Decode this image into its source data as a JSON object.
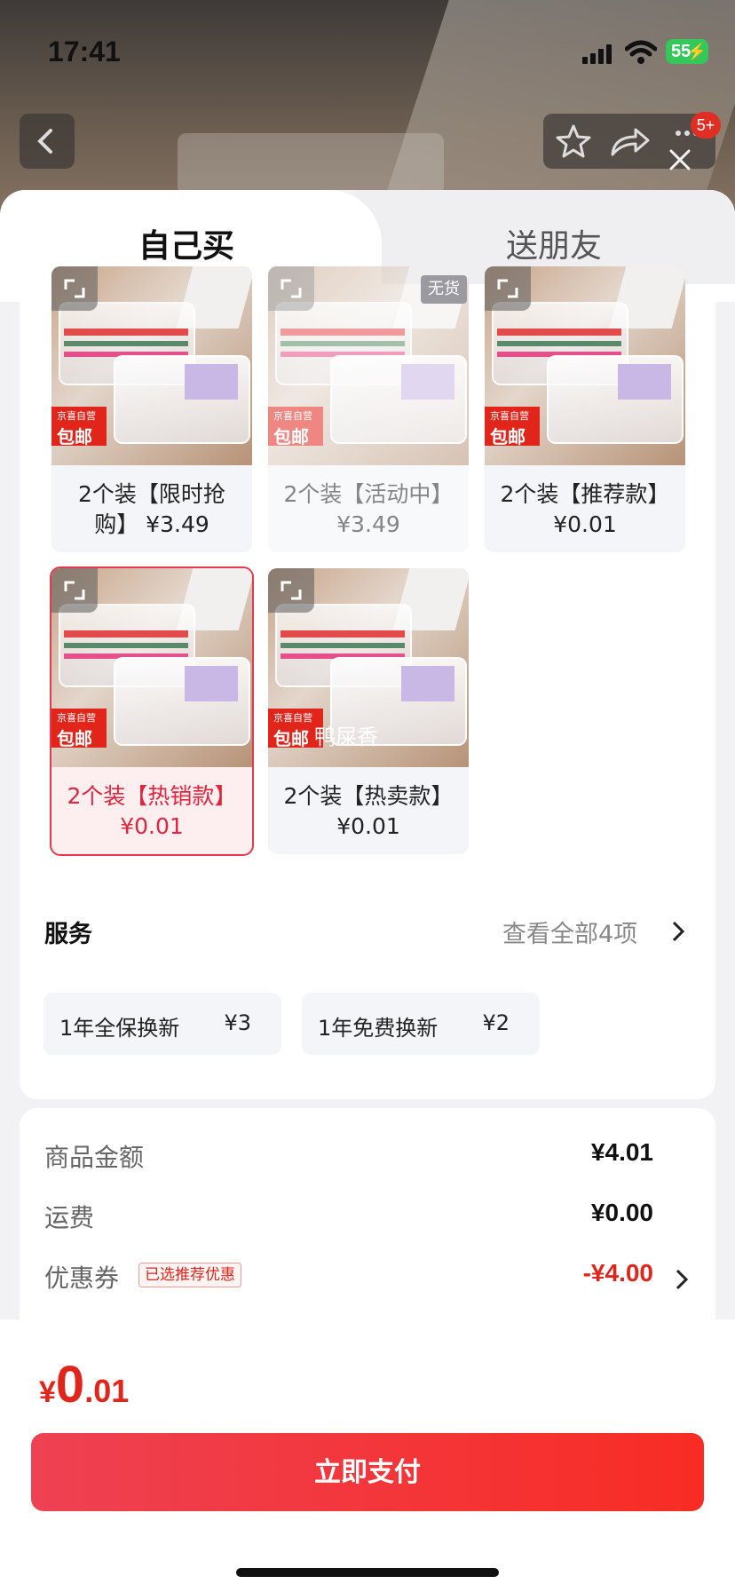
{
  "status_bar": {
    "time": "17:41",
    "battery": "55"
  },
  "nav": {
    "badge": "5+"
  },
  "tabs": [
    {
      "label": "自己买"
    },
    {
      "label": "送朋友"
    }
  ],
  "skus": [
    {
      "label": "2个装【限时抢购】 ¥3.49",
      "tag_line1": "京喜自营",
      "tag_line2": "包邮",
      "state": "normal"
    },
    {
      "label": "2个装【活动中】 ¥3.49",
      "tag_line1": "京喜自营",
      "tag_line2": "包邮",
      "state": "disabled",
      "oos": "无货"
    },
    {
      "label": "2个装【推荐款】 ¥0.01",
      "tag_line1": "京喜自营",
      "tag_line2": "包邮",
      "state": "normal"
    },
    {
      "label": "2个装【热销款】 ¥0.01",
      "tag_line1": "京喜自营",
      "tag_line2": "包邮",
      "state": "selected"
    },
    {
      "label": "2个装【热卖款】 ¥0.01",
      "tag_line1": "京喜自营",
      "tag_line2": "包邮",
      "state": "normal",
      "overlay": "鸭屎香"
    }
  ],
  "services": {
    "title": "服务",
    "more": "查看全部4项",
    "items": [
      {
        "name": "1年全保换新",
        "price": "¥3"
      },
      {
        "name": "1年免费换新",
        "price": "¥2"
      }
    ]
  },
  "summary": {
    "goods_label": "商品金额",
    "goods_value": "¥4.01",
    "shipping_label": "运费",
    "shipping_value": "¥0.00",
    "coupon_label": "优惠券",
    "coupon_tag": "已选推荐优惠",
    "coupon_value": "-¥4.00"
  },
  "footer": {
    "currency": "¥",
    "total_int": "0",
    "total_dec": ".01",
    "pay_label": "立即支付"
  },
  "colors": {
    "accent": "#e1251b",
    "selected_border": "#e6394d",
    "pay_gradient_start": "#ee4153",
    "pay_gradient_end": "#f82c24"
  }
}
